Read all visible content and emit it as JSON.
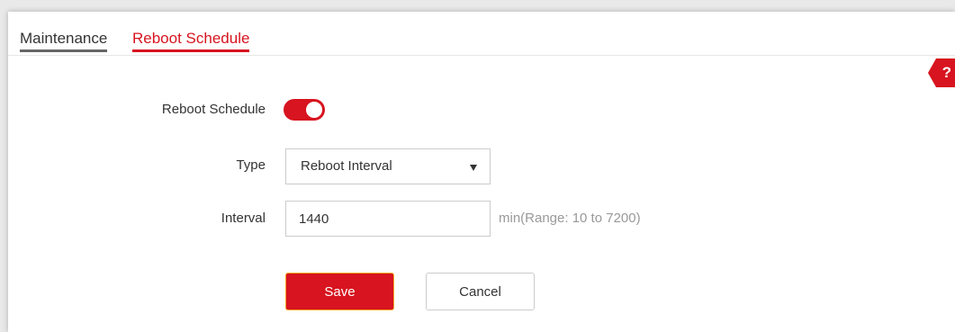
{
  "tabs": {
    "maintenance": "Maintenance",
    "reboot_schedule": "Reboot Schedule"
  },
  "help": {
    "label": "?"
  },
  "form": {
    "reboot_schedule_label": "Reboot Schedule",
    "reboot_schedule_enabled": true,
    "type_label": "Type",
    "type_value": "Reboot Interval",
    "interval_label": "Interval",
    "interval_value": "1440",
    "interval_hint": "min(Range: 10 to 7200)"
  },
  "buttons": {
    "save": "Save",
    "cancel": "Cancel"
  },
  "colors": {
    "accent": "#d7141f",
    "focus_border": "#f5a623"
  }
}
